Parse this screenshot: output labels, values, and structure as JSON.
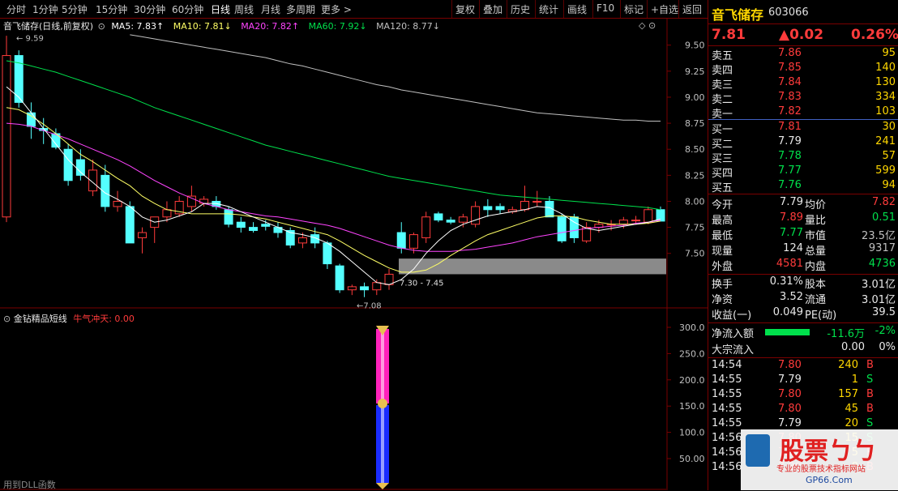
{
  "toolbar": {
    "periods": [
      "分时",
      "1分钟",
      "5分钟",
      "15分钟",
      "30分钟",
      "60分钟",
      "日线",
      "周线",
      "月线",
      "多周期",
      "更多 >"
    ],
    "active_period": "日线",
    "buttons": [
      "复权",
      "叠加",
      "历史",
      "统计",
      "画线",
      "F10",
      "标记",
      "+自选",
      "返回"
    ]
  },
  "main_legend": {
    "title": "音飞储存(日线,前复权)",
    "ma5": "MA5: 7.83↑",
    "ma10": "MA10: 7.81↓",
    "ma20": "MA20: 7.82↑",
    "ma60": "MA60: 7.92↓",
    "ma120": "MA120: 8.77↓"
  },
  "annotations": {
    "high_label": "9.59",
    "low_label": "7.08",
    "range_label": "7.30 - 7.45"
  },
  "price_axis": [
    "9.50",
    "9.25",
    "9.00",
    "8.75",
    "8.50",
    "8.25",
    "8.00",
    "7.75",
    "7.50"
  ],
  "sub_legend": {
    "title": "金钻精品短线",
    "indicator": "牛气冲天: 0.00"
  },
  "sub_axis": [
    "300.0",
    "250.0",
    "200.0",
    "150.0",
    "100.0",
    "50.00"
  ],
  "footer_hint": "用到DLL函数",
  "colors": {
    "up": "#ff3b3b",
    "down": "#54ffff",
    "ma5": "#ffffff",
    "ma10": "#ffff66",
    "ma20": "#ff44ff",
    "ma60": "#00e04c",
    "ma120": "#c0c0c0",
    "border": "#7a0000"
  },
  "chart_data": {
    "type": "candlestick",
    "ylim": [
      7.0,
      9.7
    ],
    "candles": [
      {
        "o": 7.85,
        "h": 9.59,
        "l": 7.8,
        "c": 9.4
      },
      {
        "o": 9.4,
        "h": 9.45,
        "l": 8.9,
        "c": 8.95
      },
      {
        "o": 8.85,
        "h": 8.95,
        "l": 8.6,
        "c": 8.72
      },
      {
        "o": 8.7,
        "h": 8.8,
        "l": 8.55,
        "c": 8.68
      },
      {
        "o": 8.65,
        "h": 8.7,
        "l": 8.5,
        "c": 8.52
      },
      {
        "o": 8.5,
        "h": 8.55,
        "l": 8.15,
        "c": 8.2
      },
      {
        "o": 8.4,
        "h": 8.5,
        "l": 8.2,
        "c": 8.25
      },
      {
        "o": 8.1,
        "h": 8.4,
        "l": 8.05,
        "c": 8.3
      },
      {
        "o": 8.25,
        "h": 8.35,
        "l": 7.9,
        "c": 7.95
      },
      {
        "o": 7.95,
        "h": 8.1,
        "l": 7.9,
        "c": 8.0
      },
      {
        "o": 7.95,
        "h": 8.0,
        "l": 7.6,
        "c": 7.6
      },
      {
        "o": 7.65,
        "h": 7.75,
        "l": 7.5,
        "c": 7.7
      },
      {
        "o": 7.75,
        "h": 7.85,
        "l": 7.6,
        "c": 7.85
      },
      {
        "o": 7.85,
        "h": 8.0,
        "l": 7.8,
        "c": 7.92
      },
      {
        "o": 7.88,
        "h": 8.05,
        "l": 7.85,
        "c": 8.0
      },
      {
        "o": 7.95,
        "h": 8.15,
        "l": 7.9,
        "c": 8.05
      },
      {
        "o": 7.98,
        "h": 8.05,
        "l": 7.95,
        "c": 8.02
      },
      {
        "o": 8.0,
        "h": 8.05,
        "l": 7.92,
        "c": 7.95
      },
      {
        "o": 7.92,
        "h": 7.95,
        "l": 7.75,
        "c": 7.78
      },
      {
        "o": 7.8,
        "h": 7.85,
        "l": 7.7,
        "c": 7.75
      },
      {
        "o": 7.75,
        "h": 7.8,
        "l": 7.7,
        "c": 7.72
      },
      {
        "o": 7.78,
        "h": 7.82,
        "l": 7.72,
        "c": 7.76
      },
      {
        "o": 7.75,
        "h": 7.8,
        "l": 7.65,
        "c": 7.7
      },
      {
        "o": 7.72,
        "h": 7.75,
        "l": 7.55,
        "c": 7.58
      },
      {
        "o": 7.6,
        "h": 7.7,
        "l": 7.55,
        "c": 7.65
      },
      {
        "o": 7.68,
        "h": 7.75,
        "l": 7.55,
        "c": 7.6
      },
      {
        "o": 7.6,
        "h": 7.62,
        "l": 7.35,
        "c": 7.4
      },
      {
        "o": 7.38,
        "h": 7.4,
        "l": 7.12,
        "c": 7.15
      },
      {
        "o": 7.15,
        "h": 7.2,
        "l": 7.1,
        "c": 7.18
      },
      {
        "o": 7.18,
        "h": 7.22,
        "l": 7.08,
        "c": 7.15
      },
      {
        "o": 7.15,
        "h": 7.25,
        "l": 7.1,
        "c": 7.22
      },
      {
        "o": 7.2,
        "h": 7.35,
        "l": 7.15,
        "c": 7.3
      },
      {
        "o": 7.7,
        "h": 7.8,
        "l": 7.5,
        "c": 7.55
      },
      {
        "o": 7.55,
        "h": 7.7,
        "l": 7.5,
        "c": 7.68
      },
      {
        "o": 7.65,
        "h": 7.9,
        "l": 7.6,
        "c": 7.85
      },
      {
        "o": 7.88,
        "h": 7.9,
        "l": 7.8,
        "c": 7.82
      },
      {
        "o": 7.82,
        "h": 7.85,
        "l": 7.78,
        "c": 7.8
      },
      {
        "o": 7.8,
        "h": 7.88,
        "l": 7.75,
        "c": 7.85
      },
      {
        "o": 7.78,
        "h": 8.0,
        "l": 7.75,
        "c": 7.95
      },
      {
        "o": 7.95,
        "h": 8.02,
        "l": 7.85,
        "c": 7.92
      },
      {
        "o": 7.95,
        "h": 7.98,
        "l": 7.88,
        "c": 7.92
      },
      {
        "o": 7.9,
        "h": 7.95,
        "l": 7.88,
        "c": 7.92
      },
      {
        "o": 7.92,
        "h": 8.15,
        "l": 7.9,
        "c": 8.0
      },
      {
        "o": 8.0,
        "h": 8.1,
        "l": 7.95,
        "c": 8.0
      },
      {
        "o": 8.0,
        "h": 8.05,
        "l": 7.85,
        "c": 7.85
      },
      {
        "o": 7.85,
        "h": 7.88,
        "l": 7.6,
        "c": 7.62
      },
      {
        "o": 7.85,
        "h": 7.88,
        "l": 7.6,
        "c": 7.65
      },
      {
        "o": 7.62,
        "h": 7.8,
        "l": 7.6,
        "c": 7.75
      },
      {
        "o": 7.75,
        "h": 7.82,
        "l": 7.7,
        "c": 7.78
      },
      {
        "o": 7.78,
        "h": 7.82,
        "l": 7.72,
        "c": 7.78
      },
      {
        "o": 7.78,
        "h": 7.85,
        "l": 7.74,
        "c": 7.82
      },
      {
        "o": 7.82,
        "h": 7.86,
        "l": 7.78,
        "c": 7.82
      },
      {
        "o": 7.8,
        "h": 7.95,
        "l": 7.78,
        "c": 7.92
      },
      {
        "o": 7.92,
        "h": 7.95,
        "l": 7.82,
        "c": 7.81
      }
    ],
    "ma5": [
      9.1,
      9.0,
      8.85,
      8.7,
      8.55,
      8.4,
      8.28,
      8.18,
      8.08,
      8.02,
      7.95,
      7.85,
      7.8,
      7.82,
      7.86,
      7.9,
      7.98,
      7.98,
      7.95,
      7.9,
      7.85,
      7.8,
      7.75,
      7.7,
      7.68,
      7.65,
      7.6,
      7.52,
      7.42,
      7.32,
      7.22,
      7.2,
      7.25,
      7.35,
      7.5,
      7.62,
      7.72,
      7.78,
      7.82,
      7.86,
      7.88,
      7.9,
      7.92,
      7.95,
      7.94,
      7.88,
      7.8,
      7.74,
      7.72,
      7.74,
      7.76,
      7.78,
      7.8,
      7.83
    ],
    "ma10": [
      8.9,
      8.88,
      8.82,
      8.74,
      8.65,
      8.55,
      8.45,
      8.38,
      8.3,
      8.22,
      8.15,
      8.05,
      7.98,
      7.92,
      7.9,
      7.88,
      7.88,
      7.88,
      7.88,
      7.87,
      7.85,
      7.83,
      7.8,
      7.77,
      7.74,
      7.71,
      7.68,
      7.62,
      7.55,
      7.48,
      7.42,
      7.36,
      7.32,
      7.32,
      7.34,
      7.4,
      7.48,
      7.55,
      7.62,
      7.68,
      7.72,
      7.76,
      7.8,
      7.84,
      7.86,
      7.86,
      7.85,
      7.82,
      7.8,
      7.78,
      7.78,
      7.78,
      7.79,
      7.81
    ],
    "ma20": [
      8.75,
      8.74,
      8.72,
      8.68,
      8.64,
      8.6,
      8.55,
      8.5,
      8.45,
      8.4,
      8.34,
      8.27,
      8.2,
      8.14,
      8.08,
      8.03,
      7.98,
      7.95,
      7.92,
      7.9,
      7.88,
      7.86,
      7.85,
      7.83,
      7.81,
      7.79,
      7.77,
      7.74,
      7.7,
      7.66,
      7.62,
      7.58,
      7.55,
      7.53,
      7.52,
      7.52,
      7.52,
      7.53,
      7.54,
      7.56,
      7.58,
      7.6,
      7.63,
      7.66,
      7.68,
      7.7,
      7.72,
      7.74,
      7.75,
      7.76,
      7.77,
      7.79,
      7.8,
      7.82
    ],
    "ma60": [
      9.35,
      9.33,
      9.3,
      9.27,
      9.24,
      9.2,
      9.16,
      9.12,
      9.08,
      9.04,
      9.0,
      8.95,
      8.9,
      8.86,
      8.82,
      8.78,
      8.74,
      8.7,
      8.66,
      8.62,
      8.58,
      8.54,
      8.51,
      8.48,
      8.45,
      8.42,
      8.39,
      8.36,
      8.33,
      8.3,
      8.27,
      8.24,
      8.22,
      8.2,
      8.18,
      8.16,
      8.14,
      8.12,
      8.1,
      8.08,
      8.06,
      8.05,
      8.04,
      8.03,
      8.02,
      8.01,
      8.0,
      7.99,
      7.98,
      7.97,
      7.96,
      7.95,
      7.94,
      7.92
    ],
    "ma120": [
      null,
      null,
      null,
      null,
      null,
      null,
      null,
      null,
      null,
      null,
      9.6,
      9.58,
      9.56,
      9.54,
      9.52,
      9.5,
      9.48,
      9.46,
      9.44,
      9.42,
      9.4,
      9.38,
      9.35,
      9.32,
      9.3,
      9.27,
      9.24,
      9.21,
      9.18,
      9.15,
      9.12,
      9.1,
      9.07,
      9.05,
      9.03,
      9.01,
      8.99,
      8.97,
      8.95,
      8.93,
      8.91,
      8.89,
      8.87,
      8.85,
      8.84,
      8.83,
      8.82,
      8.81,
      8.8,
      8.79,
      8.78,
      8.78,
      8.77,
      8.77
    ]
  },
  "panel": {
    "name": "音飞储存",
    "code": "603066",
    "price": "7.81",
    "change": "▲0.02",
    "pct": "0.26%",
    "asks": [
      {
        "label": "卖五",
        "price": "7.86",
        "vol": "95"
      },
      {
        "label": "卖四",
        "price": "7.85",
        "vol": "140"
      },
      {
        "label": "卖三",
        "price": "7.84",
        "vol": "130"
      },
      {
        "label": "卖二",
        "price": "7.83",
        "vol": "334"
      },
      {
        "label": "卖一",
        "price": "7.82",
        "vol": "103"
      }
    ],
    "bids": [
      {
        "label": "买一",
        "price": "7.81",
        "vol": "30",
        "cls": "red"
      },
      {
        "label": "买二",
        "price": "7.79",
        "vol": "241",
        "cls": "white"
      },
      {
        "label": "买三",
        "price": "7.78",
        "vol": "57",
        "cls": "green"
      },
      {
        "label": "买四",
        "price": "7.77",
        "vol": "599",
        "cls": "green"
      },
      {
        "label": "买五",
        "price": "7.76",
        "vol": "94",
        "cls": "green"
      }
    ],
    "stats1": [
      {
        "l1": "今开",
        "v1": "7.79",
        "c1": "white",
        "l2": "均价",
        "v2": "7.82",
        "c2": "red"
      },
      {
        "l1": "最高",
        "v1": "7.89",
        "c1": "red",
        "l2": "量比",
        "v2": "0.51",
        "c2": "green"
      },
      {
        "l1": "最低",
        "v1": "7.77",
        "c1": "green",
        "l2": "市值",
        "v2": "23.5亿",
        "c2": "gray"
      },
      {
        "l1": "现量",
        "v1": "124",
        "c1": "white",
        "l2": "总量",
        "v2": "9317",
        "c2": "gray"
      },
      {
        "l1": "外盘",
        "v1": "4581",
        "c1": "red",
        "l2": "内盘",
        "v2": "4736",
        "c2": "green"
      }
    ],
    "stats2": [
      {
        "l1": "换手",
        "v1": "0.31%",
        "l2": "股本",
        "v2": "3.01亿"
      },
      {
        "l1": "净资",
        "v1": "3.52",
        "l2": "流通",
        "v2": "3.01亿"
      },
      {
        "l1": "收益(一)",
        "v1": "0.049",
        "l2": "PE(动)",
        "v2": "39.5"
      }
    ],
    "flow": [
      {
        "label": "净流入额",
        "value": "-11.6万",
        "pct": "-2%",
        "bar": true
      },
      {
        "label": "大宗流入",
        "value": "0.00",
        "pct": "0%",
        "bar": false
      }
    ],
    "ticks": [
      {
        "time": "14:54",
        "price": "7.80",
        "pcls": "red",
        "vol": "240",
        "side": "B",
        "scls": "red"
      },
      {
        "time": "14:55",
        "price": "7.79",
        "pcls": "white",
        "vol": "1",
        "side": "S",
        "scls": "green"
      },
      {
        "time": "14:55",
        "price": "7.80",
        "pcls": "red",
        "vol": "157",
        "side": "B",
        "scls": "red"
      },
      {
        "time": "14:55",
        "price": "7.80",
        "pcls": "red",
        "vol": "45",
        "side": "B",
        "scls": "red"
      },
      {
        "time": "14:55",
        "price": "7.79",
        "pcls": "white",
        "vol": "20",
        "side": "S",
        "scls": "green"
      },
      {
        "time": "14:56",
        "price": "7.80",
        "pcls": "red",
        "vol": "15",
        "side": "S",
        "scls": "green"
      },
      {
        "time": "14:56",
        "price": "7.80",
        "pcls": "red",
        "vol": "5",
        "side": "B",
        "scls": "red"
      },
      {
        "time": "14:56",
        "price": "7.80",
        "pcls": "red",
        "vol": "8",
        "side": "B",
        "scls": "red"
      }
    ],
    "watermark_text": "股票ㄅㄅ",
    "watermark_sub": "专业的股票技术指标网站",
    "watermark_url": "GP66.Com"
  }
}
